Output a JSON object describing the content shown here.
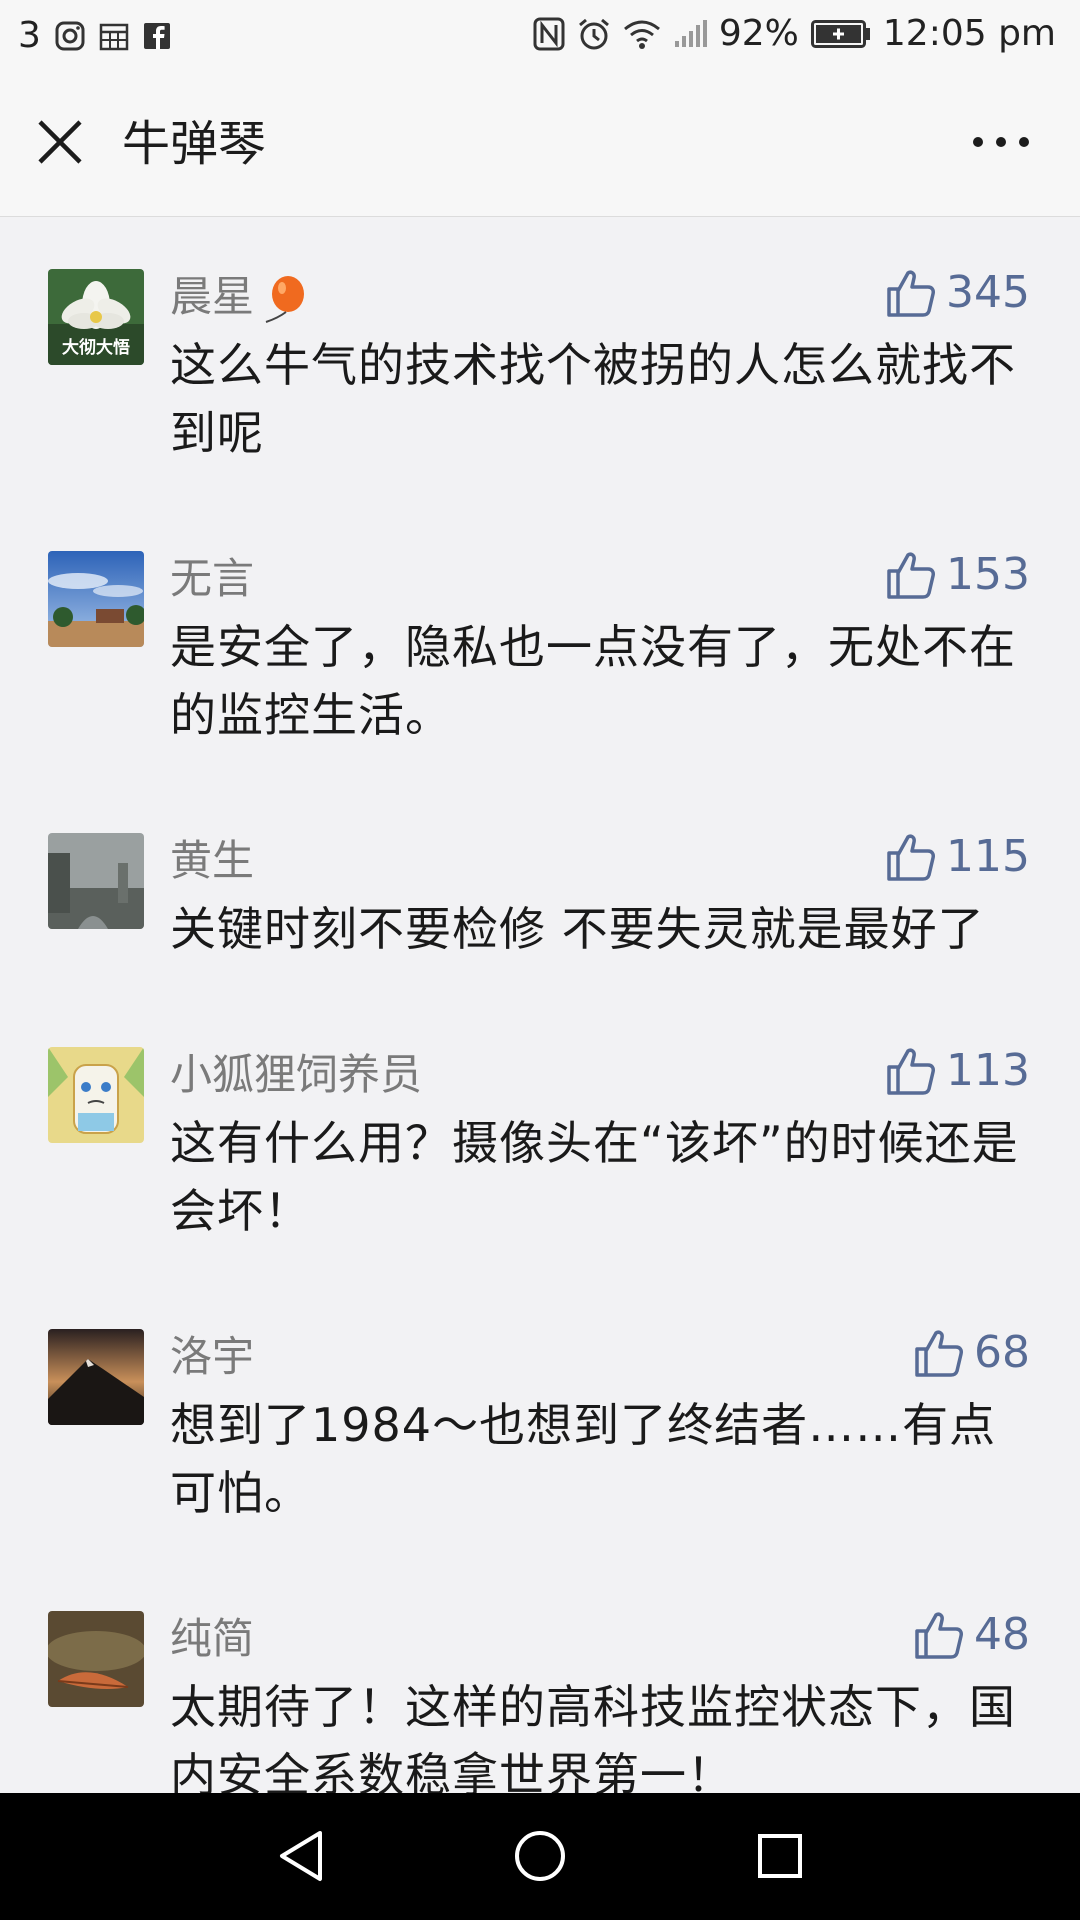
{
  "status_bar": {
    "notification_count": "3",
    "left_icons": [
      "instagram-icon",
      "calendar-icon",
      "facebook-icon"
    ],
    "right_icons": [
      "nfc-icon",
      "alarm-icon",
      "wifi-icon",
      "signal-icon"
    ],
    "battery": "92%",
    "time": "12:05 pm"
  },
  "header": {
    "title": "牛弹琴",
    "close_icon": "close-icon",
    "more_icon": "more-dots-icon"
  },
  "colors": {
    "like_blue": "#576b95",
    "nickname_gray": "#7a7a7a",
    "background": "#f2f2f4"
  },
  "comments": [
    {
      "nickname": "晨星",
      "likes": "345",
      "text": "这么牛气的技术找个被拐的人怎么就找不到呢",
      "avatar_text": "大彻大悟"
    },
    {
      "nickname": "无言",
      "likes": "153",
      "text": "是安全了，隐私也一点没有了，无处不在的监控生活。"
    },
    {
      "nickname": "黄生",
      "likes": "115",
      "text": "关键时刻不要检修 不要失灵就是最好了"
    },
    {
      "nickname": "小狐狸饲养员",
      "likes": "113",
      "text": "这有什么用？摄像头在“该坏”的时候还是会坏！"
    },
    {
      "nickname": "洛宇",
      "likes": "68",
      "text": "想到了1984～也想到了终结者……有点可怕。"
    },
    {
      "nickname": "纯简",
      "likes": "48",
      "text": "太期待了！这样的高科技监控状态下，国内安全系数稳拿世界第一！"
    }
  ],
  "nav": {
    "icons": [
      "back-triangle-icon",
      "home-circle-icon",
      "recents-square-icon"
    ]
  }
}
